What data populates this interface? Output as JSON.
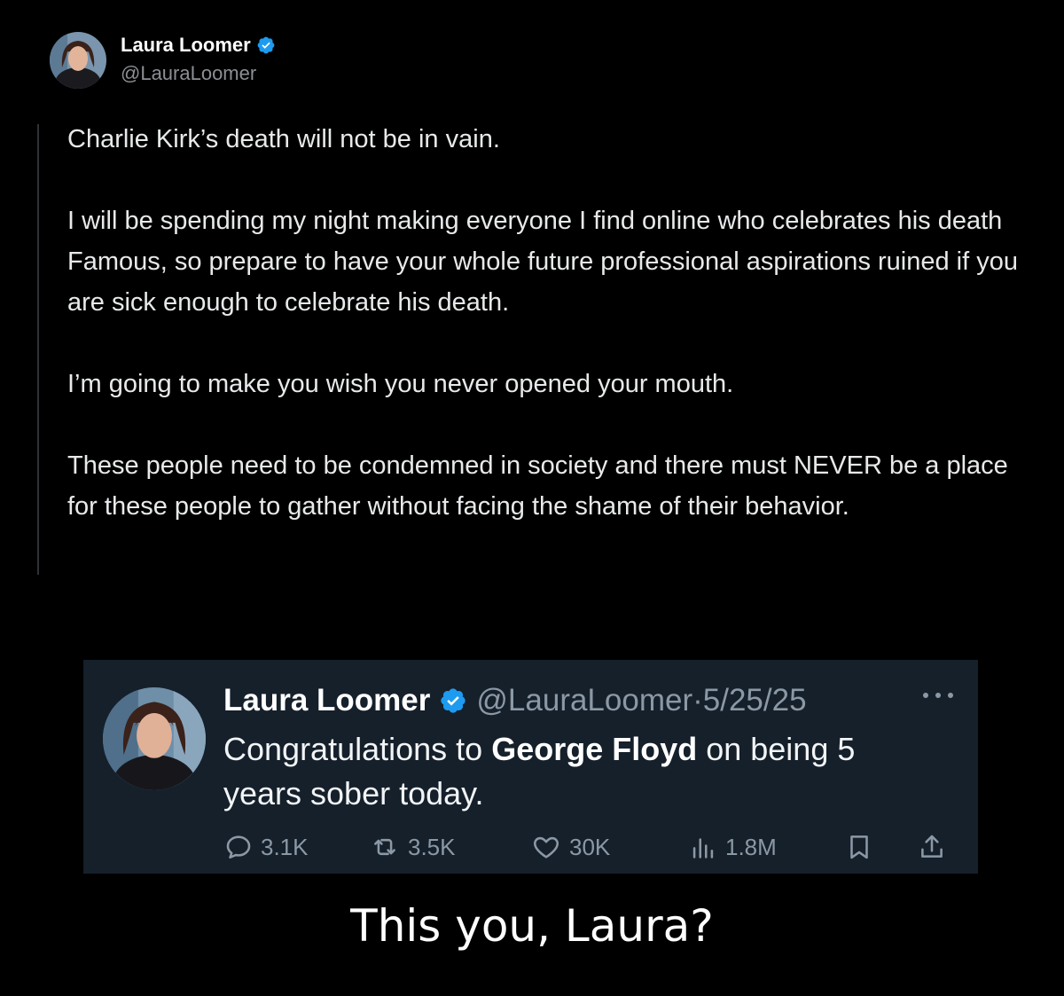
{
  "top_tweet": {
    "author_name": "Laura Loomer",
    "author_handle": "@LauraLoomer",
    "verified": true,
    "paragraphs": [
      "Charlie Kirk’s death will not be in vain.",
      "I will be spending my night making everyone I find online who celebrates his death Famous, so prepare to have your whole future professional aspirations ruined if you are sick enough to celebrate his death.",
      "I’m going to make you wish you never opened your mouth.",
      "These people need to be condemned in society and there must NEVER be a place for these people to gather without facing the shame of their behavior."
    ]
  },
  "embedded_tweet": {
    "author_name": "Laura Loomer",
    "author_handle": "@LauraLoomer",
    "separator": "·",
    "date": "5/25/25",
    "verified": true,
    "text_before": "Congratulations to ",
    "text_bold": "George Floyd",
    "text_after": " on being 5 years sober today.",
    "stats": {
      "replies": "3.1K",
      "reposts": "3.5K",
      "likes": "30K",
      "views": "1.8M"
    },
    "icons": [
      "reply-icon",
      "repost-icon",
      "like-icon",
      "views-icon",
      "bookmark-icon",
      "share-icon",
      "more-icon"
    ]
  },
  "caption": "This you, Laura?",
  "colors": {
    "background": "#000000",
    "embed_background": "#15202b",
    "verified_blue": "#1d9bf0",
    "muted_text": "#8b98a5"
  }
}
